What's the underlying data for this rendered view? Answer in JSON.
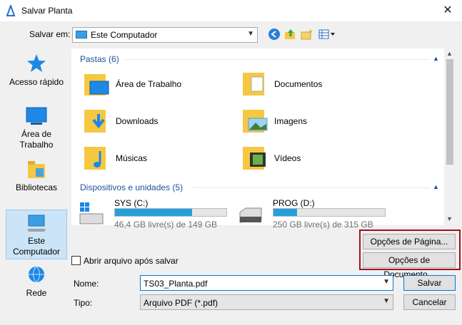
{
  "window": {
    "title": "Salvar Planta",
    "close_icon": "✕"
  },
  "savein": {
    "label": "Salvar em:",
    "value": "Este Computador"
  },
  "places": [
    {
      "label": "Acesso rápido"
    },
    {
      "label": "Área de Trabalho"
    },
    {
      "label": "Bibliotecas"
    },
    {
      "label": "Este Computador"
    },
    {
      "label": "Rede"
    }
  ],
  "folders_group": {
    "header": "Pastas (6)",
    "items": [
      "Área de Trabalho",
      "Documentos",
      "Downloads",
      "Imagens",
      "Músicas",
      "Vídeos"
    ]
  },
  "devices_group": {
    "header": "Dispositivos e unidades (5)",
    "items": [
      {
        "name": "SYS (C:)",
        "free": "46,4 GB livre(s) de 149 GB",
        "used_fraction": 0.69
      },
      {
        "name": "PROG (D:)",
        "free": "250 GB livre(s) de 315 GB",
        "used_fraction": 0.21
      }
    ]
  },
  "buttons": {
    "page_options": "Opções de Página...",
    "doc_options": "Opções de Documento...",
    "save": "Salvar",
    "cancel": "Cancelar"
  },
  "open_after_save": {
    "label": "Abrir arquivo após salvar",
    "checked": false
  },
  "name_field": {
    "label": "Nome:",
    "value": "TS03_Planta.pdf"
  },
  "type_field": {
    "label": "Tipo:",
    "value": "Arquivo PDF (*.pdf)"
  },
  "colors": {
    "accent": "#0078d7",
    "highlight_box": "#a1131a",
    "folder": "#f5c842",
    "bar_fill": "#26a0da"
  }
}
